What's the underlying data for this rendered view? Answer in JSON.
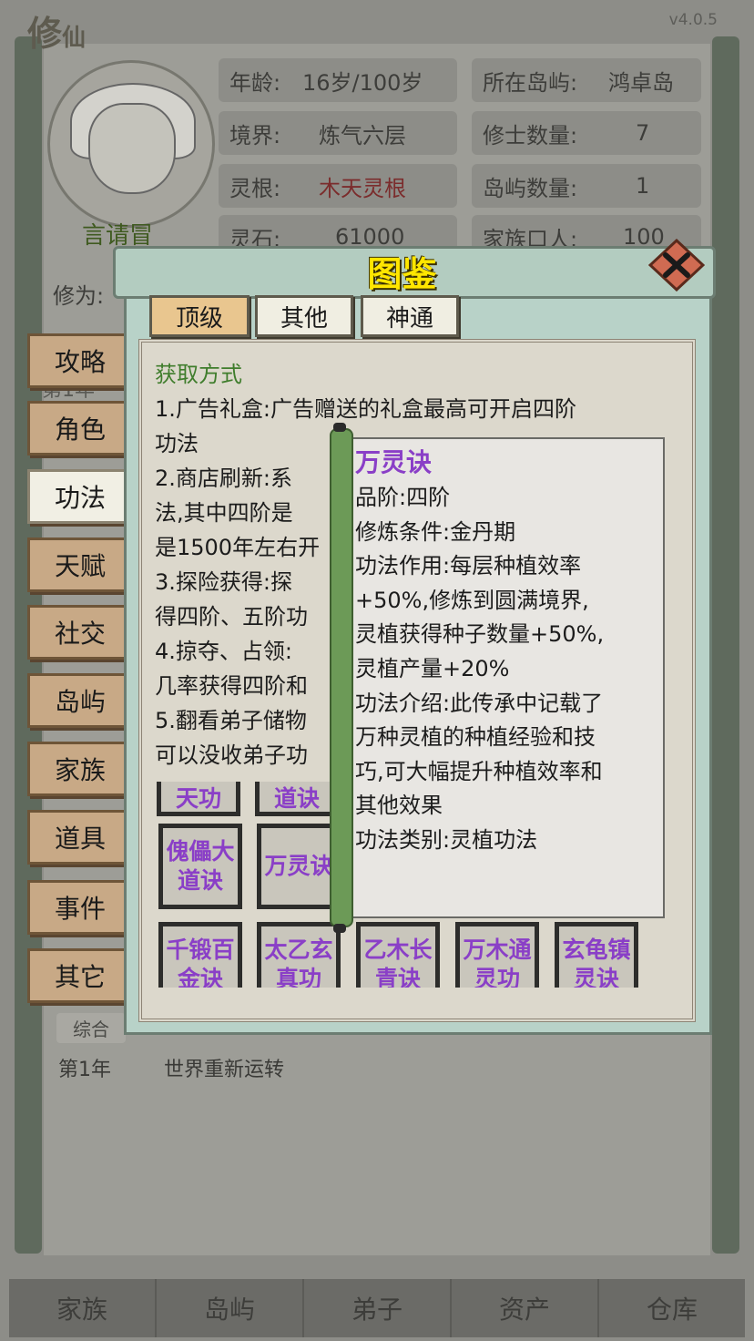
{
  "game": {
    "logo_big": "修",
    "logo_small": "仙",
    "version": "v4.0.5"
  },
  "player": {
    "name": "言请冒",
    "age_label": "年龄:",
    "age_value": "16岁/100岁",
    "realm_label": "境界:",
    "realm_value": "炼气六层",
    "root_label": "灵根:",
    "root_value": "木天灵根",
    "stone_label": "灵石:",
    "stone_value": "61000",
    "island_label": "所在岛屿:",
    "island_value": "鸿卓岛",
    "cultivators_label": "修士数量:",
    "cultivators_value": "7",
    "islands_label": "岛屿数量:",
    "islands_value": "1",
    "family_label": "家族口人:",
    "family_value": "100",
    "cultivation_label": "修为:"
  },
  "background": {
    "year_tag": "第1年",
    "log_tab": "综合",
    "log_year": "第1年",
    "log_text": "世界重新运转"
  },
  "bottom_nav": [
    "家族",
    "岛屿",
    "弟子",
    "资产",
    "仓库"
  ],
  "side_menu": [
    {
      "label": "攻略",
      "active": false
    },
    {
      "label": "角色",
      "active": false
    },
    {
      "label": "功法",
      "active": true
    },
    {
      "label": "天赋",
      "active": false
    },
    {
      "label": "社交",
      "active": false
    },
    {
      "label": "岛屿",
      "active": false
    },
    {
      "label": "家族",
      "active": false
    },
    {
      "label": "道具",
      "active": false
    },
    {
      "label": "事件",
      "active": false
    },
    {
      "label": "其它",
      "active": false
    }
  ],
  "dialog": {
    "title": "图鉴",
    "tabs": [
      {
        "label": "顶级",
        "active": true
      },
      {
        "label": "其他",
        "active": false
      },
      {
        "label": "神通",
        "active": false
      }
    ],
    "acquire_header": "获取方式",
    "acquire_lines": [
      "1.广告礼盒:广告赠送的礼盒最高可开启四阶",
      "功法",
      "2.商店刷新:系",
      "法,其中四阶是",
      "是1500年左右开",
      "3.探险获得:探",
      "得四阶、五阶功",
      "4.掠夺、占领:",
      "几率获得四阶和",
      "5.翻看弟子储物",
      "可以没收弟子功"
    ],
    "grid_row1": [
      "天功",
      "道诀"
    ],
    "grid_row2": [
      "傀儡大道诀",
      "万灵诀"
    ],
    "grid_row3": [
      "千锻百金诀",
      "太乙玄真功",
      "乙木长青诀",
      "万木通灵功",
      "玄龟镇灵诀"
    ]
  },
  "detail": {
    "name": "万灵诀",
    "lines": [
      "品阶:四阶",
      "修炼条件:金丹期",
      "功法作用:每层种植效率",
      "+50%,修炼到圆满境界,",
      "灵植获得种子数量+50%,",
      "灵植产量+20%",
      "功法介绍:此传承中记载了",
      "万种灵植的种植经验和技",
      "巧,可大幅提升种植效率和",
      "其他效果",
      "功法类别:灵植功法"
    ]
  },
  "colors": {
    "accent_title": "#ffe600",
    "skill_name": "#8a3fc7",
    "acquire_header": "#3f7d2c",
    "root_value": "#7b2c2c"
  }
}
